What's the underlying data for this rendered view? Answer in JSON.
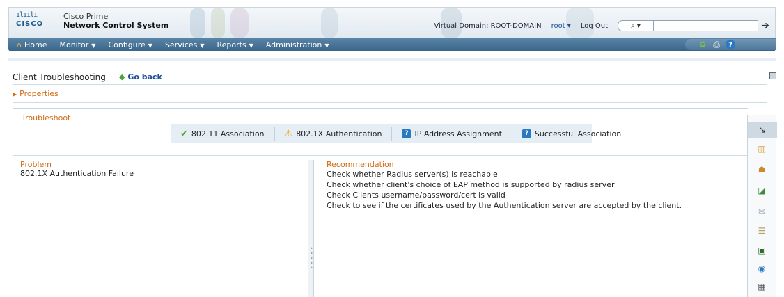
{
  "header": {
    "logo_bars": "ılıılı",
    "logo_text": "CISCO",
    "product_line1": "Cisco Prime",
    "product_line2": "Network Control System",
    "virtual_domain": "Virtual Domain: ROOT-DOMAIN",
    "user": "root ▾",
    "logout": "Log Out",
    "search_scope": "⌕ ▾",
    "go_icon": "➔"
  },
  "nav": {
    "items": [
      {
        "label": "Home"
      },
      {
        "label": "Monitor",
        "caret": "▼"
      },
      {
        "label": "Configure",
        "caret": "▼"
      },
      {
        "label": "Services",
        "caret": "▼"
      },
      {
        "label": "Reports",
        "caret": "▼"
      },
      {
        "label": "Administration",
        "caret": "▼"
      }
    ],
    "home_icon": "⌂"
  },
  "page": {
    "title": "Client Troubleshooting",
    "go_back": "Go back",
    "go_back_icon": "◆",
    "properties": "Properties",
    "properties_icon": "▶"
  },
  "troubleshoot": {
    "title": "Troubleshoot",
    "steps": [
      {
        "label": "802.11 Association",
        "status": "success",
        "icon": "✔"
      },
      {
        "label": "802.1X Authentication",
        "status": "warning",
        "icon": "⚠"
      },
      {
        "label": "IP Address Assignment",
        "status": "unknown",
        "icon": "?"
      },
      {
        "label": "Successful Association",
        "status": "unknown",
        "icon": "?"
      }
    ],
    "problem_heading": "Problem",
    "problem_text": "802.1X Authentication Failure",
    "recommendation_heading": "Recommendation",
    "recommendations": [
      "Check whether Radius server(s) is reachable",
      "Check whether client's choice of EAP method is supported by radius server",
      "Check Clients username/password/cert is valid",
      "Check to see if the certificates used by the Authentication server are accepted by the client."
    ]
  },
  "toolbar": {
    "icons": [
      "wrench-icon",
      "report-icon",
      "user-group-icon",
      "chart-icon",
      "mail-icon",
      "list-icon",
      "monitor-icon",
      "globe-icon",
      "grid-icon"
    ],
    "glyphs": [
      "↘",
      "▥",
      "☗",
      "◪",
      "✉",
      "☰",
      "▣",
      "◉",
      "▦"
    ]
  },
  "colors": {
    "accent_orange": "#d06b10",
    "nav_blue": "#3a6487",
    "link_blue": "#1f4f98",
    "success_green": "#4aa02c",
    "warning_amber": "#f3a41c"
  }
}
